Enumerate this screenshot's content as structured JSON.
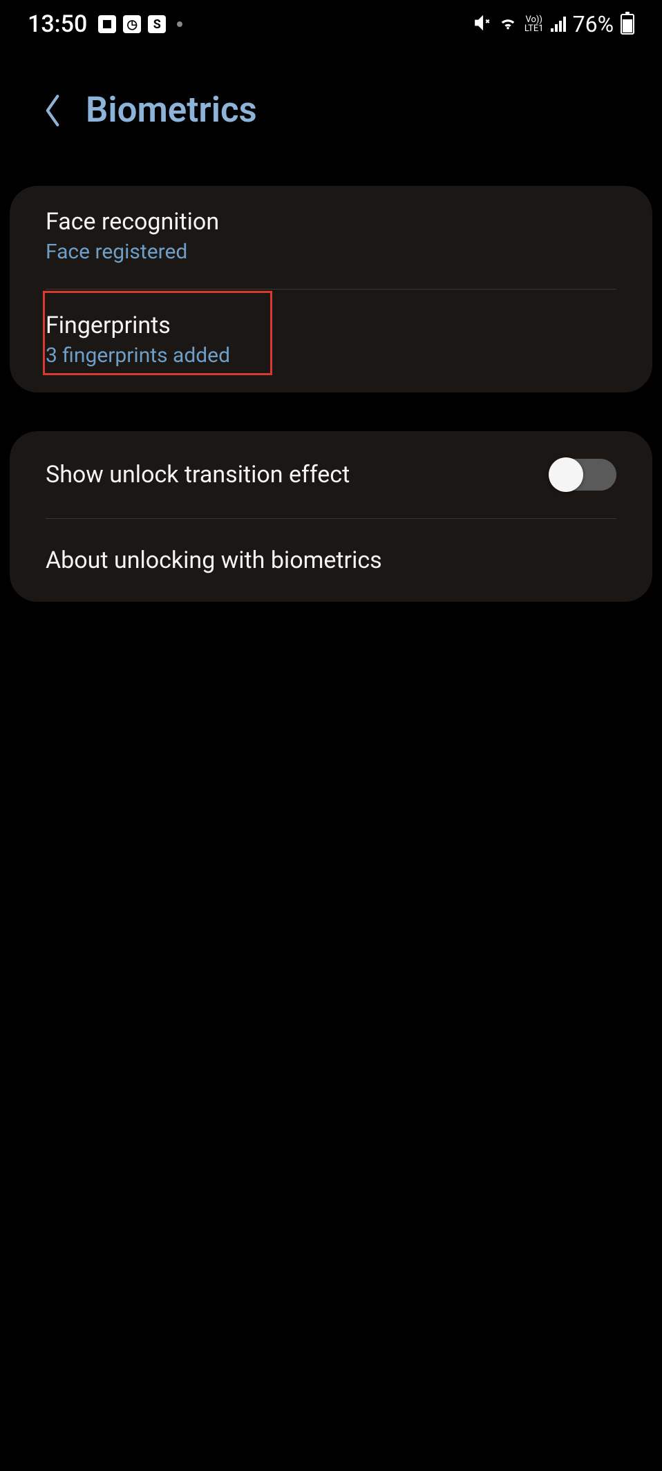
{
  "statusbar": {
    "time": "13:50",
    "battery_percent": "76%",
    "network_label": "Vo))\nLTE1"
  },
  "header": {
    "title": "Biometrics"
  },
  "items": {
    "face": {
      "title": "Face recognition",
      "sub": "Face registered"
    },
    "fingerprints": {
      "title": "Fingerprints",
      "sub": "3 fingerprints added"
    },
    "transition": {
      "title": "Show unlock transition effect",
      "toggle_on": false
    },
    "about": {
      "title": "About unlocking with biometrics"
    }
  },
  "colors": {
    "accent": "#8db4d8",
    "link": "#6e9fc9",
    "card_bg": "#1a1714",
    "highlight_border": "#d93a2f"
  }
}
